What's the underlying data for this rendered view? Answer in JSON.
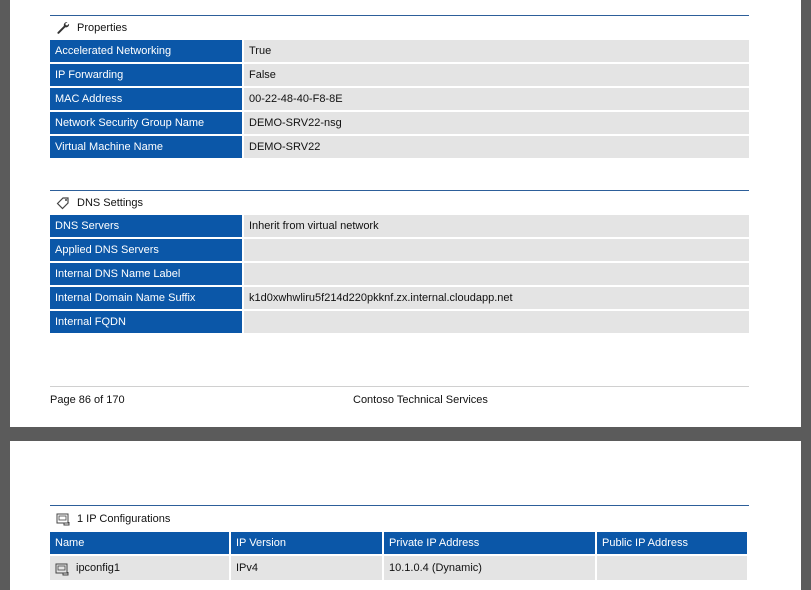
{
  "properties": {
    "title": "Properties",
    "icon": "wrench-icon",
    "rows": [
      {
        "key": "Accelerated Networking",
        "value": "True"
      },
      {
        "key": "IP Forwarding",
        "value": "False"
      },
      {
        "key": "MAC Address",
        "value": "00-22-48-40-F8-8E"
      },
      {
        "key": "Network Security Group Name",
        "value": "DEMO-SRV22-nsg"
      },
      {
        "key": "Virtual Machine Name",
        "value": "DEMO-SRV22"
      }
    ]
  },
  "dns": {
    "title": "DNS Settings",
    "icon": "tag-icon",
    "rows": [
      {
        "key": "DNS Servers",
        "value": "Inherit from virtual network"
      },
      {
        "key": "Applied DNS Servers",
        "value": ""
      },
      {
        "key": "Internal DNS Name Label",
        "value": ""
      },
      {
        "key": "Internal Domain Name Suffix",
        "value": "k1d0xwhwliru5f214d220pkknf.zx.internal.cloudapp.net"
      },
      {
        "key": "Internal FQDN",
        "value": ""
      }
    ]
  },
  "footer": {
    "page": "Page 86 of 170",
    "company": "Contoso Technical Services"
  },
  "ipconfigs": {
    "title": "1 IP Configurations",
    "icon": "network-card-icon",
    "headers": [
      "Name",
      "IP Version",
      "Private IP Address",
      "Public IP Address"
    ],
    "rows": [
      {
        "name": "ipconfig1",
        "version": "IPv4",
        "private": "10.1.0.4 (Dynamic)",
        "public": ""
      }
    ]
  },
  "colors": {
    "header_blue": "#0b57a8",
    "cell_gray": "#e4e4e4",
    "rule_blue": "#2d5f9a"
  }
}
